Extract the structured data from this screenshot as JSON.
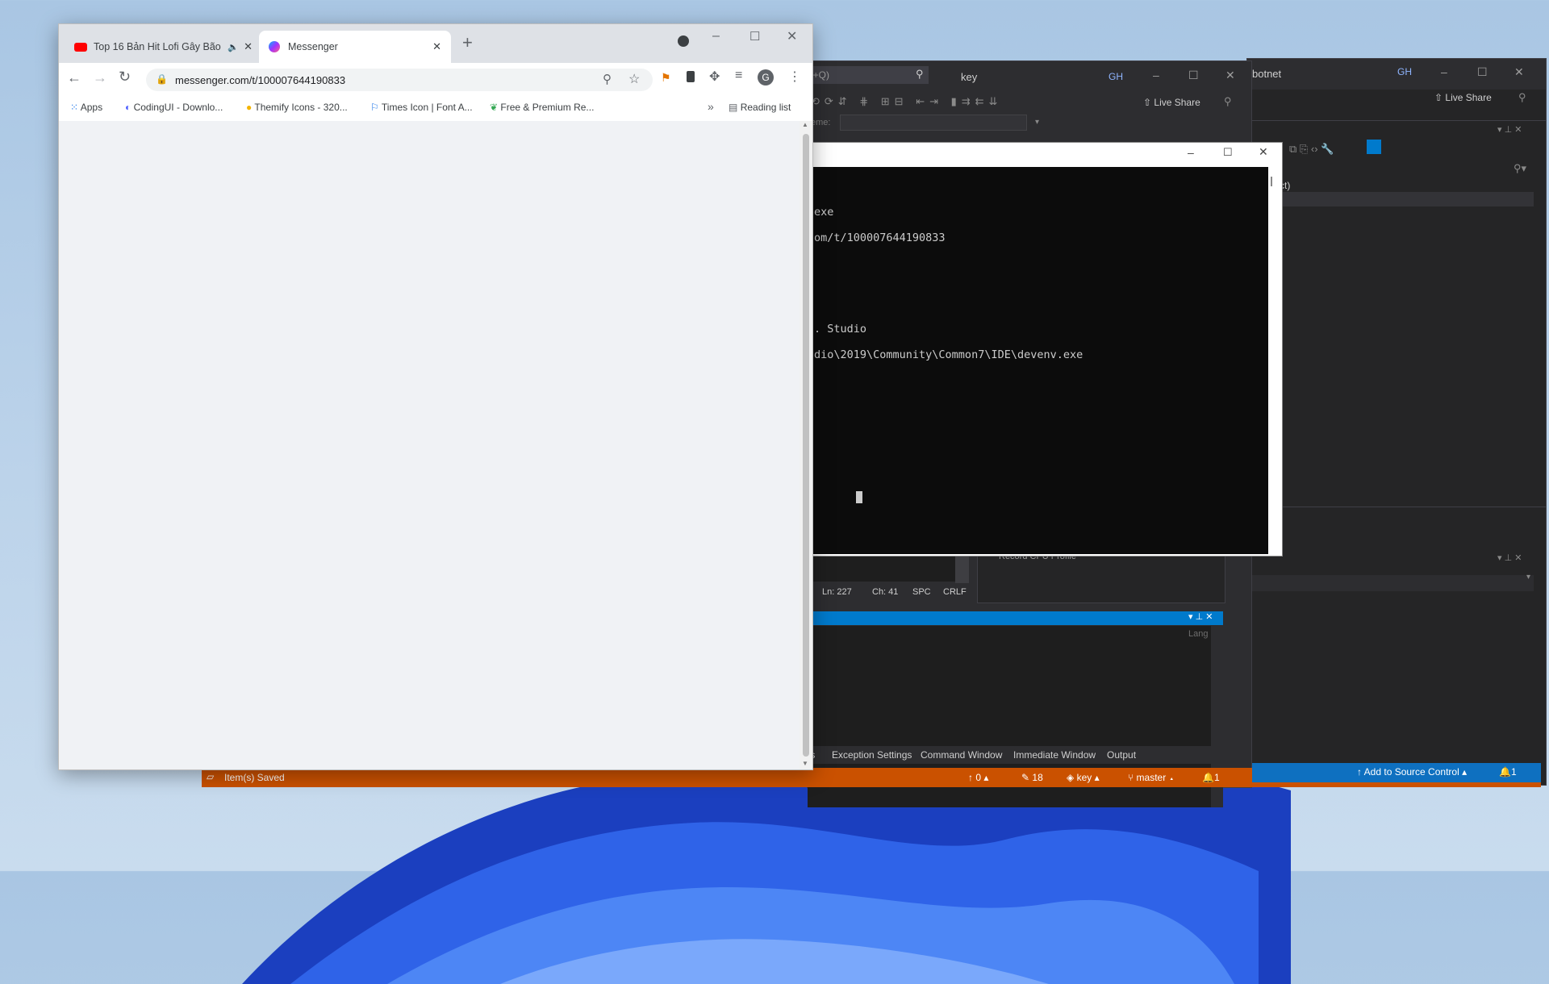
{
  "colors": {
    "vs_status_orange": "#ca5100",
    "vs_status_blue": "#0e70c0",
    "console_bg": "#0c0c0c",
    "chrome_content_bg": "#f0f2f5"
  },
  "chrome": {
    "tabs": [
      {
        "title": "Top 16 Bản Hit Lofi Gây Bão",
        "icon": "youtube-icon",
        "audio_icon": "speaker-icon"
      },
      {
        "title": "Messenger",
        "icon": "messenger-icon",
        "active": true
      }
    ],
    "new_tab": "+",
    "url": "messenger.com/t/100007644190833",
    "bookmarks": [
      {
        "label": "Apps",
        "icon": "apps-grid-icon"
      },
      {
        "label": "CodingUI - Downlo...",
        "icon": "codingui-icon"
      },
      {
        "label": "Themify Icons - 320...",
        "icon": "emoji-icon"
      },
      {
        "label": "Times Icon | Font A...",
        "icon": "flag-icon"
      },
      {
        "label": "Free & Premium Re...",
        "icon": "leaf-icon"
      }
    ],
    "more_bookmarks": "»",
    "reading_list": "Reading list",
    "profile_initial": "G"
  },
  "vs_front": {
    "search_placeholder": "l+Q)",
    "solution_name": "key",
    "avatar": "GH",
    "live_share": "Live Share",
    "frame_label": "eme:",
    "ln": "Ln: 227",
    "ch": "Ch: 41",
    "spc": "SPC",
    "crlf": "CRLF",
    "record_label": "Record CPU Profile",
    "lang_header": "Lang",
    "bottom_tabs": [
      "ts",
      "Exception Settings",
      "Command Window",
      "Immediate Window",
      "Output"
    ]
  },
  "vs_back": {
    "title_fragment": "botnet",
    "avatar": "GH",
    "live_share": "Live Share",
    "tree_item": "oject)",
    "add_to_source_control": "Add to Source Control",
    "notif_count": "1"
  },
  "console": {
    "lines": [
      "exe",
      "om/t/100007644190833",
      ". Studio",
      "dio\\2019\\Community\\Common7\\IDE\\devenv.exe"
    ]
  },
  "statusbar": {
    "message": "Item(s) Saved",
    "push_count": "0",
    "changes_count": "18",
    "repo": "key",
    "branch": "master",
    "notif": "1"
  }
}
